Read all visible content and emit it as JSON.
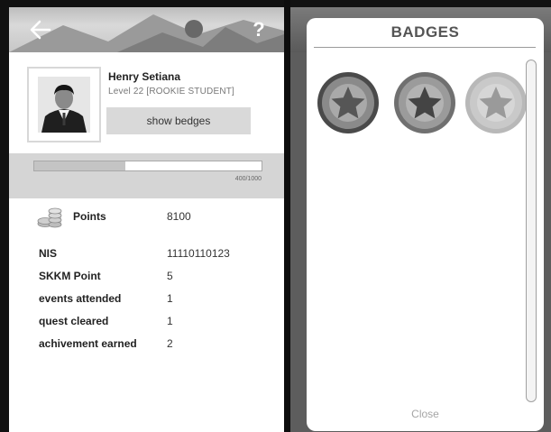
{
  "profile": {
    "name": "Henry Setiana",
    "level": "Level 22 [ROOKIE STUDENT]",
    "show_button": "show bedges"
  },
  "progress": {
    "text": "400/1000",
    "fraction": 0.4
  },
  "header": {
    "help_label": "?"
  },
  "stats": {
    "points_label": "Points",
    "points_value": "8100",
    "nis_label": "NIS",
    "nis_value": "11110110123",
    "skkm_label": "SKKM Point",
    "skkm_value": "5",
    "events_label": "events attended",
    "events_value": "1",
    "quest_label": "quest cleared",
    "quest_value": "1",
    "achievement_label": "achivement earned",
    "achievement_value": "2"
  },
  "badges_modal": {
    "title": "BADGES",
    "close_label": "Close",
    "badges": [
      "star-badge",
      "star-badge",
      "star-badge"
    ]
  },
  "icons": {
    "back": "back-arrow-icon",
    "coins": "coins-icon",
    "badge": "star-icon"
  }
}
